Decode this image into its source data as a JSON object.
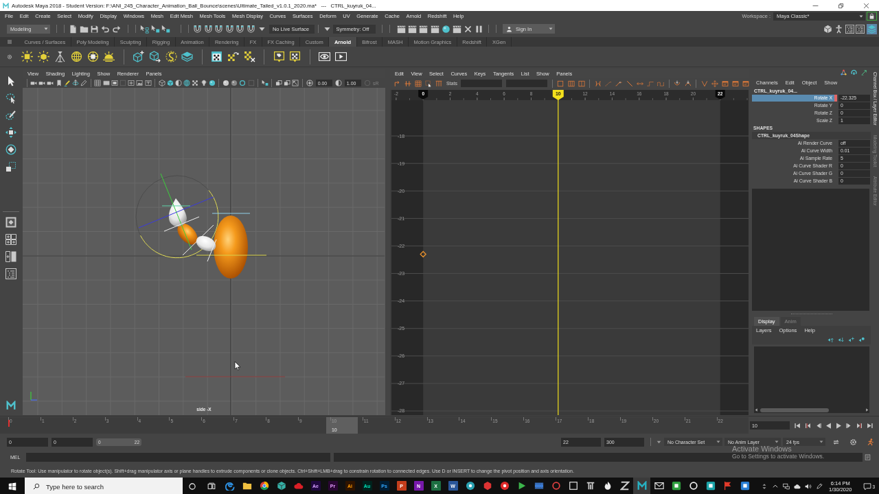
{
  "window": {
    "title": "Autodesk Maya 2018 - Student Version: F:\\ANI_245_Character_Animation_Ball_Bounce\\scenes\\Ultimate_Tailed_v1.0.1_2020.ma*   ---   CTRL_kuyruk_04..."
  },
  "menu": [
    "File",
    "Edit",
    "Create",
    "Select",
    "Modify",
    "Display",
    "Windows",
    "Mesh",
    "Edit Mesh",
    "Mesh Tools",
    "Mesh Display",
    "Curves",
    "Surfaces",
    "Deform",
    "UV",
    "Generate",
    "Cache",
    "Arnold",
    "Redshift",
    "Help"
  ],
  "workspace": {
    "label": "Workspace :",
    "value": "Maya Classic*"
  },
  "status_line": {
    "menu_set": "Modeling",
    "live_surface": "No Live Surface",
    "symmetry": "Symmetry: Off",
    "sign_in": "Sign In"
  },
  "shelf": {
    "tabs": [
      {
        "label": "Curves / Surfaces",
        "selected": false
      },
      {
        "label": "Poly Modeling",
        "selected": false
      },
      {
        "label": "Sculpting",
        "selected": false
      },
      {
        "label": "Rigging",
        "selected": false
      },
      {
        "label": "Animation",
        "selected": false
      },
      {
        "label": "Rendering",
        "selected": false
      },
      {
        "label": "FX",
        "selected": false
      },
      {
        "label": "FX Caching",
        "selected": false
      },
      {
        "label": "Custom",
        "selected": false
      },
      {
        "label": "Arnold",
        "selected": true
      },
      {
        "label": "Bifrost",
        "selected": false
      },
      {
        "label": "MASH",
        "selected": false
      },
      {
        "label": "Motion Graphics",
        "selected": false
      },
      {
        "label": "Redshift",
        "selected": false
      },
      {
        "label": "XGen",
        "selected": false
      }
    ]
  },
  "viewport": {
    "menu": [
      "View",
      "Shading",
      "Lighting",
      "Show",
      "Renderer",
      "Panels"
    ],
    "exposure": "0.00",
    "gamma": "1.00",
    "color_space": "sR",
    "camera": "side -X"
  },
  "graph_editor": {
    "menu": [
      "Edit",
      "View",
      "Select",
      "Curves",
      "Keys",
      "Tangents",
      "List",
      "Show",
      "Panels"
    ],
    "stats_label": "Stats",
    "chart_data": {
      "type": "scatter",
      "x": [
        0
      ],
      "values": [
        -22.3
      ],
      "color": "#e8912d",
      "marker": "diamond",
      "xlim": [
        -2.35,
        24.1
      ],
      "ylim": [
        -28.15,
        -16.7
      ],
      "xticks": [
        -2,
        0,
        2,
        4,
        6,
        8,
        12,
        14,
        16,
        18,
        20,
        22
      ],
      "yticks": [
        -18,
        -19,
        -20,
        -21,
        -22,
        -23,
        -24,
        -25,
        -26,
        -27,
        -28
      ],
      "grid": true,
      "ref_lines": [
        {
          "axis": "x",
          "value": 10,
          "label": "10",
          "color": "#f3e01c"
        }
      ],
      "bands": [
        {
          "axis": "x",
          "from": -2.35,
          "to": 0,
          "color": "#282828"
        },
        {
          "axis": "x",
          "from": 22,
          "to": 24.1,
          "color": "#282828"
        }
      ]
    }
  },
  "channel_box": {
    "menu": [
      "Channels",
      "Edit",
      "Object",
      "Show"
    ],
    "object": "CTRL_kuyruk_04...",
    "channels": [
      {
        "name": "Rotate X",
        "value": "-22.325",
        "selected": true,
        "keyed": true
      },
      {
        "name": "Rotate Y",
        "value": "0",
        "selected": false,
        "keyed": false
      },
      {
        "name": "Rotate Z",
        "value": "0",
        "selected": false,
        "keyed": false
      },
      {
        "name": "Scale Z",
        "value": "1",
        "selected": false,
        "keyed": false
      }
    ],
    "shapes_heading": "SHAPES",
    "shape": "CTRL_kuyruk_04Shape",
    "shape_channels": [
      {
        "name": "Ai Render Curve",
        "value": "off"
      },
      {
        "name": "Ai Curve Width",
        "value": "0.01"
      },
      {
        "name": "Ai Sample Rate",
        "value": "5"
      },
      {
        "name": "Ai Curve Shader R",
        "value": "0"
      },
      {
        "name": "Ai Curve Shader G",
        "value": "0"
      },
      {
        "name": "Ai Curve Shader B",
        "value": "0"
      }
    ]
  },
  "layer_editor": {
    "tabs": [
      {
        "label": "Display",
        "selected": true
      },
      {
        "label": "Anim",
        "selected": false
      }
    ],
    "menu": [
      "Layers",
      "Options",
      "Help"
    ]
  },
  "side_tabs": [
    {
      "label": "Channel Box / Layer Editor",
      "selected": true
    },
    {
      "label": "Modeling Toolkit",
      "selected": false
    },
    {
      "label": "Attribute Editor",
      "selected": false
    }
  ],
  "time_slider": {
    "frames": [
      {
        "label": "0",
        "selected": false,
        "key": true
      },
      {
        "label": "1",
        "selected": false,
        "key": false
      },
      {
        "label": "2",
        "selected": false,
        "key": false
      },
      {
        "label": "3",
        "selected": false,
        "key": false
      },
      {
        "label": "4",
        "selected": false,
        "key": false
      },
      {
        "label": "5",
        "selected": false,
        "key": false
      },
      {
        "label": "6",
        "selected": false,
        "key": false
      },
      {
        "label": "7",
        "selected": false,
        "key": false
      },
      {
        "label": "8",
        "selected": false,
        "key": false
      },
      {
        "label": "9",
        "selected": false,
        "key": false
      },
      {
        "label": "10",
        "selected": true,
        "key": false
      },
      {
        "label": "11",
        "selected": false,
        "key": false
      },
      {
        "label": "12",
        "selected": false,
        "key": false
      },
      {
        "label": "13",
        "selected": false,
        "key": false
      },
      {
        "label": "14",
        "selected": false,
        "key": false
      },
      {
        "label": "15",
        "selected": false,
        "key": false
      },
      {
        "label": "16",
        "selected": false,
        "key": false
      },
      {
        "label": "17",
        "selected": false,
        "key": false
      },
      {
        "label": "18",
        "selected": false,
        "key": false
      },
      {
        "label": "19",
        "selected": false,
        "key": false
      },
      {
        "label": "20",
        "selected": false,
        "key": false
      },
      {
        "label": "21",
        "selected": false,
        "key": false
      },
      {
        "label": "22",
        "selected": false,
        "key": false
      }
    ],
    "current_frame": "10",
    "frame_field": "10"
  },
  "range_slider": {
    "start": "0",
    "playback_start": "0",
    "range_start": "0",
    "range_end": "22",
    "playback_end": "22",
    "end": "300",
    "character_set": "No Character Set",
    "anim_layer": "No Anim Layer",
    "fps": "24 fps"
  },
  "command_line": {
    "language": "MEL"
  },
  "help_line": "Rotate Tool: Use manipulator to rotate object(s). Shift+drag manipulator axis or plane handles to extrude components or clone objects. Ctrl+Shift+LMB+drag to constrain rotation to connected edges. Use D or INSERT to change the pivot position and axis orientation.",
  "taskbar": {
    "search": {
      "placeholder": "Type here to search"
    },
    "apps": [
      {
        "selected": false
      },
      {
        "selected": false
      },
      {
        "selected": false
      },
      {
        "selected": false
      },
      {
        "selected": false
      },
      {
        "label": "Ae",
        "selected": false
      },
      {
        "label": "Pr",
        "selected": false
      },
      {
        "label": "Ai",
        "selected": false
      },
      {
        "label": "Au",
        "selected": false
      },
      {
        "label": "Ps",
        "selected": false
      },
      {
        "label": "P",
        "selected": false
      },
      {
        "label": "N",
        "selected": false
      },
      {
        "label": "X",
        "selected": false
      },
      {
        "label": "W",
        "selected": false
      },
      {
        "selected": false
      },
      {
        "selected": false
      },
      {
        "selected": false
      },
      {
        "selected": false
      },
      {
        "selected": false
      },
      {
        "selected": false
      },
      {
        "selected": false
      },
      {
        "selected": false
      },
      {
        "selected": false
      },
      {
        "selected": false
      },
      {
        "selected": true
      },
      {
        "selected": false
      },
      {
        "selected": false
      },
      {
        "selected": false
      },
      {
        "selected": false
      },
      {
        "selected": false
      },
      {
        "selected": false
      }
    ],
    "time": "6:14 PM",
    "date": "1/30/2020",
    "notifications": "3"
  },
  "activation_notice": {
    "title": "Activate Windows",
    "text": "Go to Settings to activate Windows."
  }
}
